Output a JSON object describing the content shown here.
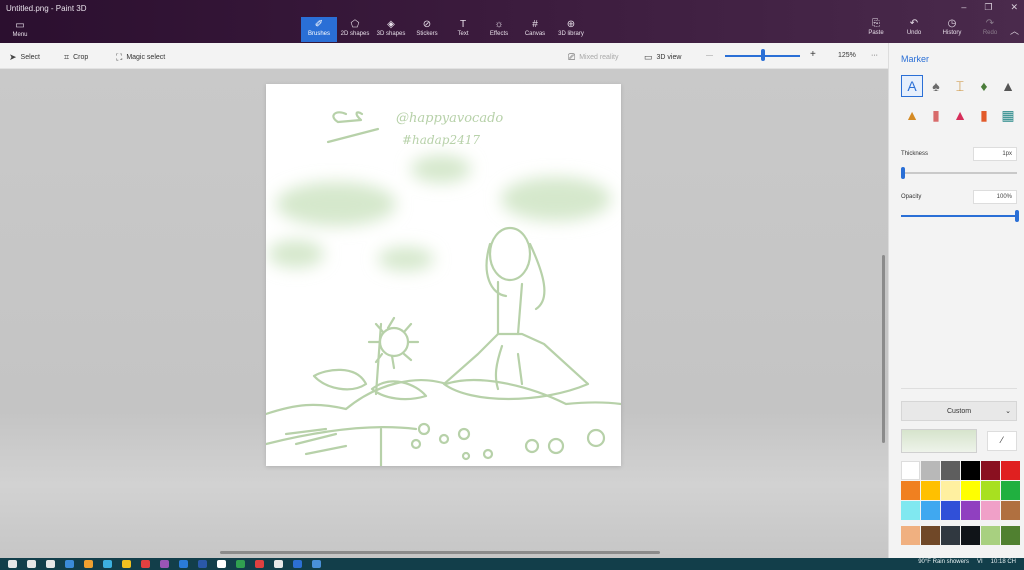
{
  "window": {
    "title": "Untitled.png - Paint 3D",
    "controls": [
      "–",
      "❐",
      "✕"
    ]
  },
  "menu": {
    "label": "Menu",
    "icon": "▭"
  },
  "tools": [
    {
      "label": "Brushes",
      "icon": "✐",
      "active": true
    },
    {
      "label": "2D shapes",
      "icon": "⬠"
    },
    {
      "label": "3D shapes",
      "icon": "◈"
    },
    {
      "label": "Stickers",
      "icon": "⊘"
    },
    {
      "label": "Text",
      "icon": "T"
    },
    {
      "label": "Effects",
      "icon": "☼"
    },
    {
      "label": "Canvas",
      "icon": "#"
    },
    {
      "label": "3D library",
      "icon": "⊕"
    }
  ],
  "right_tools": [
    {
      "label": "Paste",
      "icon": "⎘"
    },
    {
      "label": "Undo",
      "icon": "↶"
    },
    {
      "label": "History",
      "icon": "◷"
    },
    {
      "label": "Redo",
      "icon": "↷",
      "disabled": true
    }
  ],
  "subbar": {
    "select": "Select",
    "crop": "Crop",
    "magic_select": "Magic select",
    "mixed_reality": "Mixed reality",
    "view_3d": "3D view",
    "zoom_minus": "—",
    "zoom_plus": "+",
    "zoom": "125%",
    "more": "···"
  },
  "canvas_text": {
    "handle": "@happyavocado",
    "tag": "#hadap2417"
  },
  "panel": {
    "title": "Marker",
    "thickness_label": "Thickness",
    "thickness_value": "1px",
    "thickness_fraction": 0.02,
    "opacity_label": "Opacity",
    "opacity_value": "100%",
    "opacity_fraction": 1.0,
    "custom_label": "Custom",
    "custom_chevron": "⌄",
    "current_color": "#d6e4cc",
    "picker_icon": "⁄",
    "brushes": [
      {
        "name": "marker-brush",
        "icon": "A",
        "color": "#2a6fd6",
        "selected": true
      },
      {
        "name": "calligraphy-pen-brush",
        "icon": "♠",
        "color": "#6b6b6b"
      },
      {
        "name": "oil-brush",
        "icon": "⌶",
        "color": "#c98a2b"
      },
      {
        "name": "watercolor-brush",
        "icon": "♦",
        "color": "#4a7c3a"
      },
      {
        "name": "pixel-pen-brush",
        "icon": "▲",
        "color": "#555555"
      },
      {
        "name": "pencil-brush",
        "icon": "▲",
        "color": "#d48a24"
      },
      {
        "name": "eraser-brush",
        "icon": "▮",
        "color": "#d86b6b"
      },
      {
        "name": "crayon-brush",
        "icon": "▲",
        "color": "#d62e5a"
      },
      {
        "name": "spray-can-brush",
        "icon": "▮",
        "color": "#e25a2a"
      },
      {
        "name": "fill-bucket-brush",
        "icon": "▦",
        "color": "#2a8a8a"
      }
    ],
    "swatches": [
      "#ffffff",
      "#b8b8b8",
      "#5e5e5e",
      "#000000",
      "#8a1020",
      "#e02020",
      "#f08020",
      "#ffc000",
      "#fff0a0",
      "#ffff00",
      "#a8e020",
      "#20b040",
      "#80e8f0",
      "#40a8f0",
      "#3050d8",
      "#9040c0",
      "#f0a0c8",
      "#b07040"
    ],
    "swatches_custom": [
      "#f0b080",
      "#704828",
      "#303840",
      "#101418",
      "#a8d080",
      "#508030"
    ]
  },
  "taskbar": {
    "icons": [
      "#e7e7e7",
      "#e7e7e7",
      "#e7e7e7",
      "#3b8bd9",
      "#f0a030",
      "#3cb0e0",
      "#f0c020",
      "#e04040",
      "#9a55b5",
      "#2a7bd9",
      "#2a58a8",
      "#ffffff",
      "#30a050",
      "#e04040",
      "#e8e8e8",
      "#2c6fd4",
      "#4a90d9"
    ],
    "weather": "90°F Rain showers",
    "lang": "VI",
    "time": "10:18 CH"
  }
}
